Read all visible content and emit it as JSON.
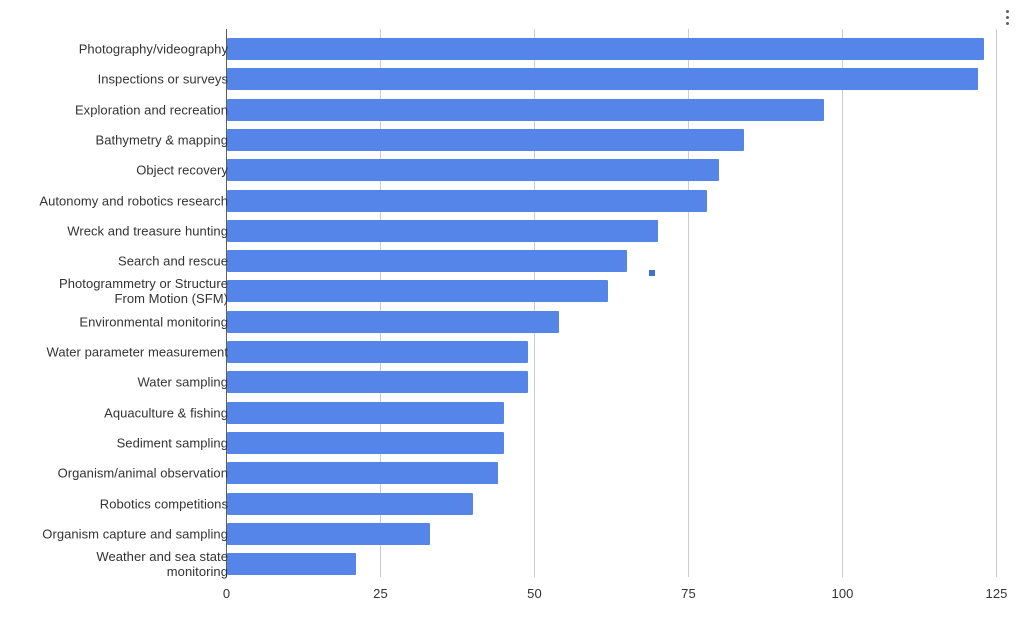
{
  "toolbar": {
    "menu_icon": "kebab-menu-icon",
    "menu_label": "⋮"
  },
  "chart_data": {
    "type": "bar",
    "orientation": "horizontal",
    "title": "",
    "xlabel": "",
    "ylabel": "",
    "xlim": [
      0,
      125
    ],
    "xticks": [
      "0",
      "25",
      "50",
      "75",
      "100",
      "125"
    ],
    "xtick_values": [
      0,
      25,
      50,
      75,
      100,
      125
    ],
    "grid": true,
    "legend": "none",
    "bar_color": "#5585E8",
    "axis_color": "#5f5f5f",
    "gridline_color": "#cccccc",
    "label_color": "#333333",
    "categories": [
      "Photography/videography",
      "Inspections or surveys",
      "Exploration and recreation",
      "Bathymetry & mapping",
      "Object recovery",
      "Autonomy and robotics research",
      "Wreck and treasure hunting",
      "Search and rescue",
      "Photogrammetry or Structure\nFrom Motion (SFM)",
      "Environmental monitoring",
      "Water parameter measurement",
      "Water sampling",
      "Aquaculture & fishing",
      "Sediment sampling",
      "Organism/animal observation",
      "Robotics competitions",
      "Organism capture and sampling",
      "Weather and sea state\nmonitoring"
    ],
    "values": [
      123,
      122,
      97,
      84,
      80,
      78,
      70,
      65,
      62,
      54,
      49,
      49,
      45,
      45,
      44,
      40,
      33,
      21
    ],
    "annotations": [
      {
        "name": "stray-data-point-marker",
        "x": 69,
        "row": 8,
        "color": "#3f72d9"
      }
    ]
  }
}
